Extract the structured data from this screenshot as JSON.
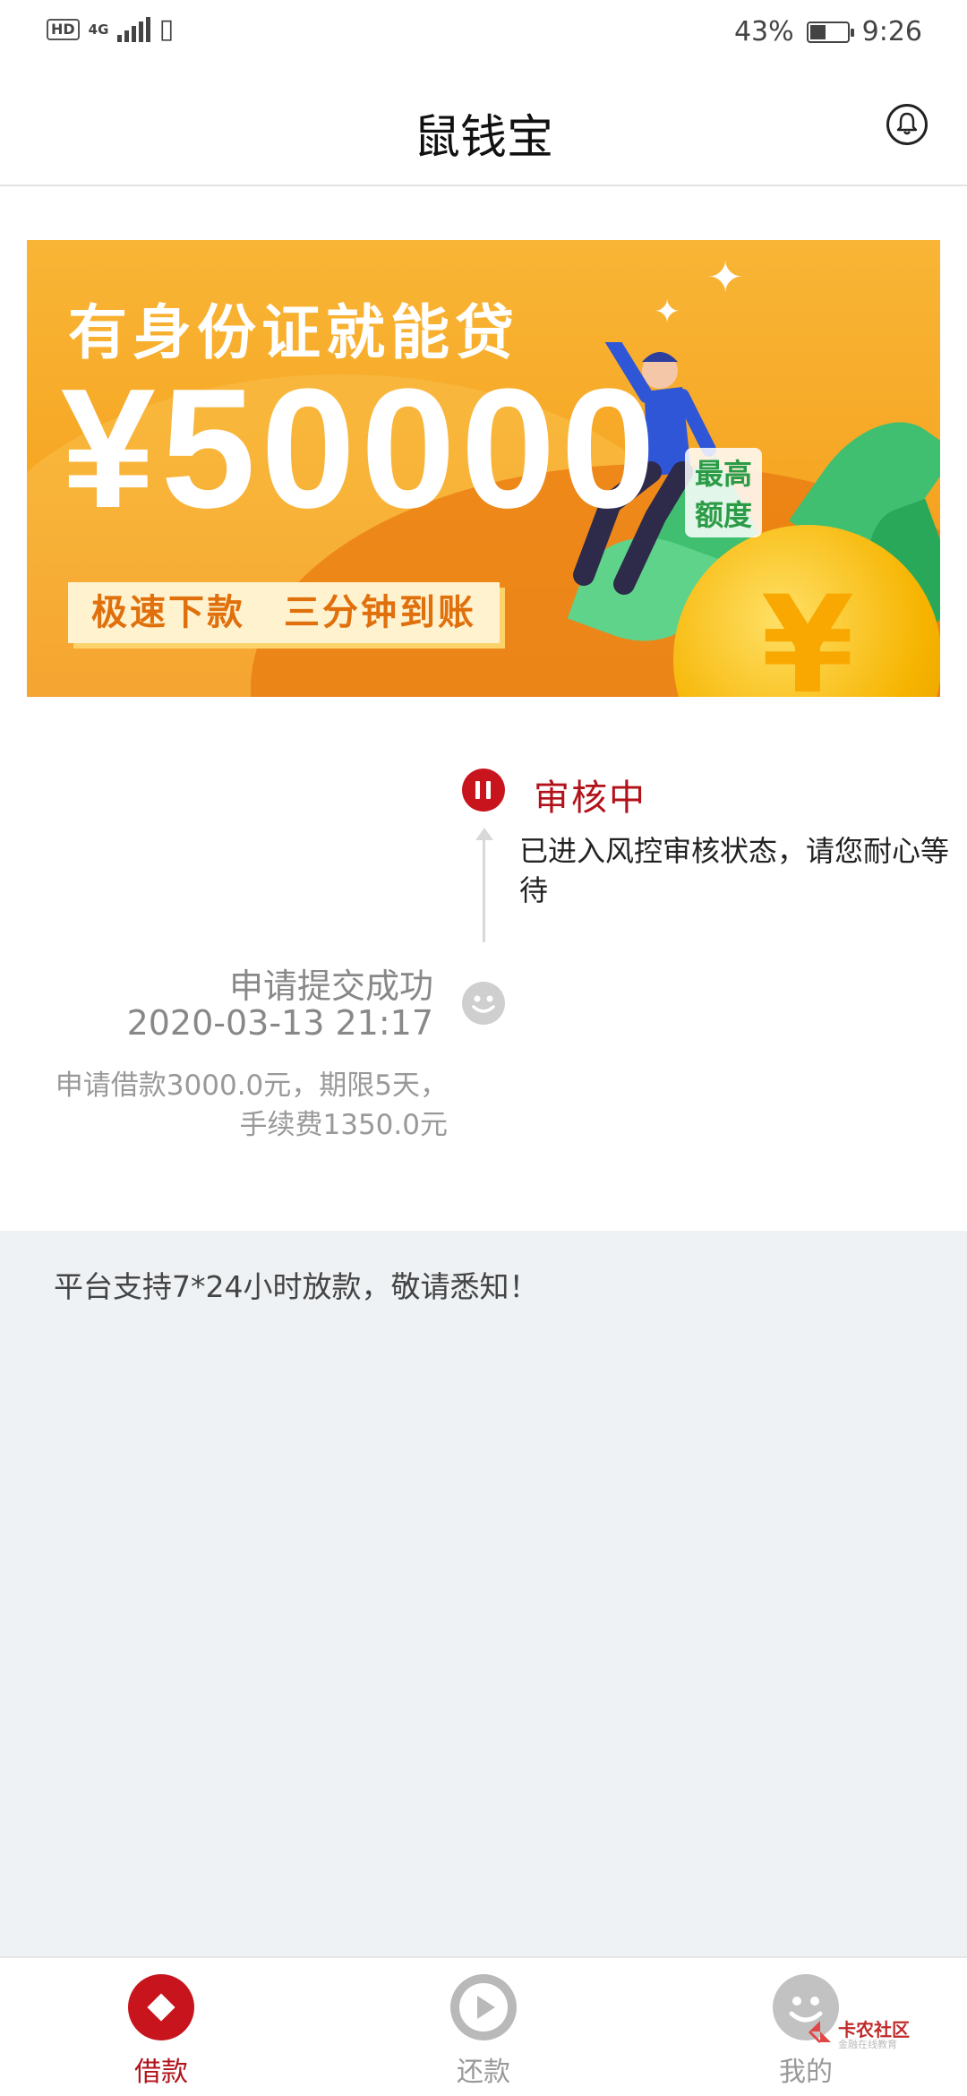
{
  "status_bar": {
    "hd": "HD",
    "network": "4G",
    "battery_percent": "43%",
    "time": "9:26"
  },
  "header": {
    "title": "鼠钱宝",
    "bell_icon": "bell-icon"
  },
  "banner": {
    "headline": "有身份证就能贷",
    "amount": "¥50000",
    "badge_line1": "最高",
    "badge_line2": "额度",
    "tagline": "极速下款　三分钟到账",
    "coin_symbol": "¥"
  },
  "progress": {
    "current": {
      "title": "审核中",
      "description": "已进入风控审核状态，请您耐心等待",
      "icon": "pause-icon",
      "color": "#c8151d"
    },
    "previous": {
      "title": "申请提交成功",
      "time": "2020-03-13 21:17",
      "description": "申请借款3000.0元，期限5天，手续费1350.0元",
      "icon": "smile-icon"
    }
  },
  "notice": {
    "text": "平台支持7*24小时放款，敬请悉知！"
  },
  "bottom_nav": {
    "items": [
      {
        "label": "借款",
        "icon": "diamond-icon",
        "active": true
      },
      {
        "label": "还款",
        "icon": "play-icon",
        "active": false
      },
      {
        "label": "我的",
        "icon": "smiley-icon",
        "active": false
      }
    ]
  },
  "watermark": {
    "text": "卡农社区",
    "subtext": "金融在线教育"
  }
}
